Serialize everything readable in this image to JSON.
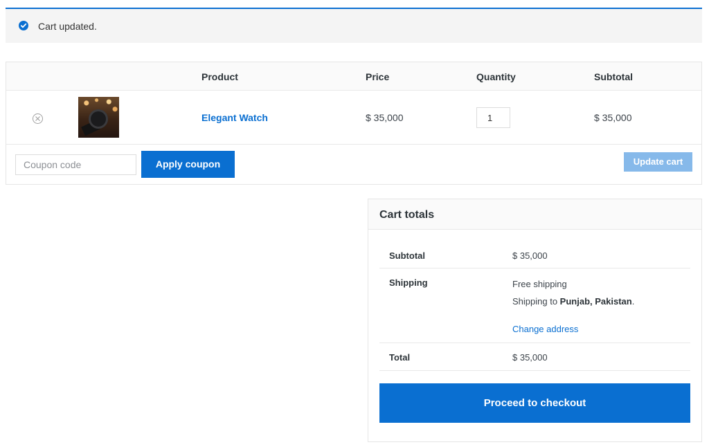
{
  "notice": {
    "message": "Cart updated.",
    "icon": "check-circle-icon",
    "accent": "#0a6fd1"
  },
  "table": {
    "headers": {
      "product": "Product",
      "price": "Price",
      "quantity": "Quantity",
      "subtotal": "Subtotal"
    },
    "items": [
      {
        "name": "Elegant Watch",
        "price": "$ 35,000",
        "quantity": "1",
        "subtotal": "$ 35,000",
        "remove_icon": "remove-circle-x-icon",
        "thumbnail": "watch-thumbnail"
      }
    ]
  },
  "actions": {
    "coupon_placeholder": "Coupon code",
    "apply_label": "Apply coupon",
    "update_label": "Update cart"
  },
  "totals": {
    "title": "Cart totals",
    "subtotal_label": "Subtotal",
    "subtotal_value": "$ 35,000",
    "shipping_label": "Shipping",
    "shipping_method": "Free shipping",
    "shipping_to_prefix": "Shipping to ",
    "shipping_location": "Punjab, Pakistan",
    "shipping_to_suffix": ".",
    "change_address": "Change address",
    "total_label": "Total",
    "total_value": "$ 35,000",
    "checkout_label": "Proceed to checkout"
  },
  "colors": {
    "primary": "#0a6fd1",
    "update_disabled": "#86b9ea",
    "notice_bg": "#f4f4f4"
  }
}
